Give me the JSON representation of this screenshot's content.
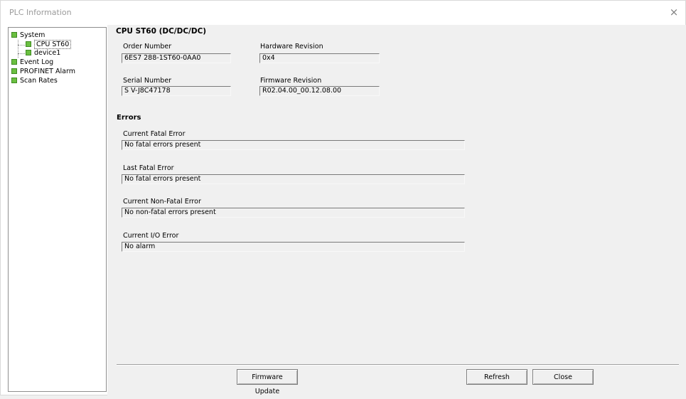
{
  "window": {
    "title": "PLC Information",
    "close_glyph": "×"
  },
  "tree": {
    "items": [
      {
        "label": "System",
        "icon": "status-ok-icon"
      },
      {
        "label": "CPU ST60",
        "icon": "status-ok-icon"
      },
      {
        "label": "device1",
        "icon": "status-ok-icon"
      },
      {
        "label": "Event Log",
        "icon": "status-ok-icon"
      },
      {
        "label": "PROFINET Alarm",
        "icon": "status-ok-icon"
      },
      {
        "label": "Scan Rates",
        "icon": "status-ok-icon"
      }
    ]
  },
  "cpu": {
    "title": "CPU ST60 (DC/DC/DC)",
    "order_number": {
      "label": "Order Number",
      "value": "6ES7 288-1ST60-0AA0"
    },
    "hardware_revision": {
      "label": "Hardware Revision",
      "value": "0x4"
    },
    "serial_number": {
      "label": "Serial Number",
      "value": "S V-J8C47178"
    },
    "firmware_revision": {
      "label": "Firmware Revision",
      "value": "R02.04.00_00.12.08.00"
    }
  },
  "errors": {
    "title": "Errors",
    "current_fatal": {
      "label": "Current Fatal Error",
      "value": "No fatal errors present"
    },
    "last_fatal": {
      "label": "Last Fatal Error",
      "value": "No fatal errors present"
    },
    "current_non_fatal": {
      "label": "Current Non-Fatal Error",
      "value": "No non-fatal errors present"
    },
    "current_io": {
      "label": "Current I/O Error",
      "value": "No alarm"
    }
  },
  "buttons": {
    "firmware_update": "Firmware Update",
    "refresh": "Refresh",
    "close": "Close"
  },
  "colors": {
    "status_ok": "#6abf40"
  }
}
